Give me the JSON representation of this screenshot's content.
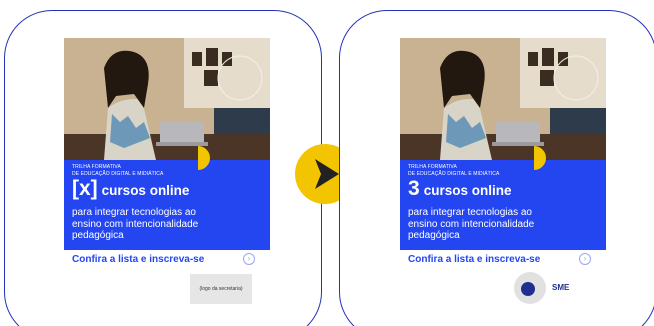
{
  "colors": {
    "frame_border": "#2432b8",
    "brand_blue": "#2446f0",
    "accent_yellow": "#f2c500",
    "sme_navy": "#1f2e8f"
  },
  "arrow": {
    "icon": "chevron-right-icon"
  },
  "cards": [
    {
      "eyebrow_line1": "TRILHA FORMATIVA",
      "eyebrow_line2": "DE EDUCAÇÃO DIGITAL E MIDIÁTICA",
      "headline_number": "[x]",
      "headline_rest": "cursos online",
      "subtitle_line1": "para integrar tecnologias ao",
      "subtitle_line2": "ensino com intencionalidade",
      "subtitle_line3": "pedagógica",
      "cta": "Confira a lista e inscreva-se",
      "cta_icon": "arrow-circle-icon",
      "logo_placeholder": "(logo da secretaria)"
    },
    {
      "eyebrow_line1": "TRILHA FORMATIVA",
      "eyebrow_line2": "DE EDUCAÇÃO DIGITAL E MIDIÁTICA",
      "headline_number": "3",
      "headline_rest": "cursos online",
      "subtitle_line1": "para integrar tecnologias ao",
      "subtitle_line2": "ensino com intencionalidade",
      "subtitle_line3": "pedagógica",
      "cta": "Confira a lista e inscreva-se",
      "cta_icon": "arrow-circle-icon",
      "logo_text": "SME"
    }
  ]
}
